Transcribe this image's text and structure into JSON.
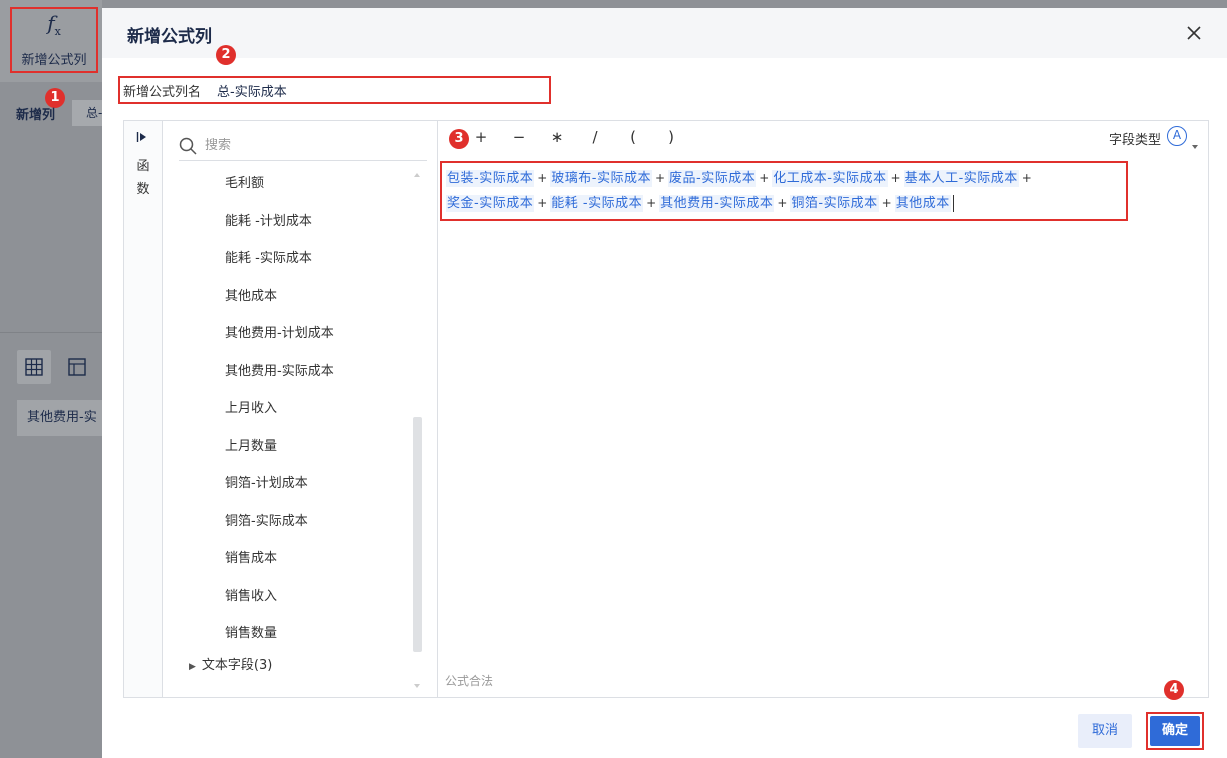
{
  "toolbar": {
    "fx_glyph": "f",
    "fx_sub": "x",
    "add_formula_label": "新增公式列"
  },
  "bg": {
    "tab_new_column": "新增列",
    "tab_partial": "总-",
    "chip_label": "其他费用-实"
  },
  "badges": {
    "b1": "1",
    "b2": "2",
    "b3": "3",
    "b4": "4"
  },
  "dialog": {
    "title": "新增公式列",
    "name_label": "新增公式列名",
    "name_value": "总-实际成本",
    "fn_toggle": "I►",
    "fn_text": "函数",
    "search_placeholder": "搜索",
    "fields": [
      "毛利额",
      "能耗 -计划成本",
      "能耗 -实际成本",
      "其他成本",
      "其他费用-计划成本",
      "其他费用-实际成本",
      "上月收入",
      "上月数量",
      "铜箔-计划成本",
      "铜箔-实际成本",
      "销售成本",
      "销售收入",
      "销售数量"
    ],
    "text_group": "文本字段(3)",
    "operators": [
      "+",
      "−",
      "∗",
      "/",
      "(",
      ")"
    ],
    "field_type_label": "字段类型",
    "field_type_icon": "A",
    "formula_tokens": [
      "包装-实际成本",
      "玻璃布-实际成本",
      "废品-实际成本",
      "化工成本-实际成本",
      "基本人工-实际成本",
      "奖金-实际成本",
      "能耗 -实际成本",
      "其他费用-实际成本",
      "铜箔-实际成本",
      "其他成本"
    ],
    "formula_op": "+",
    "formula_status": "公式合法",
    "cancel_label": "取消",
    "ok_label": "确定"
  },
  "colors": {
    "accent": "#2f6bd8",
    "highlight": "#e0302c",
    "overlay": "#8e9196"
  }
}
